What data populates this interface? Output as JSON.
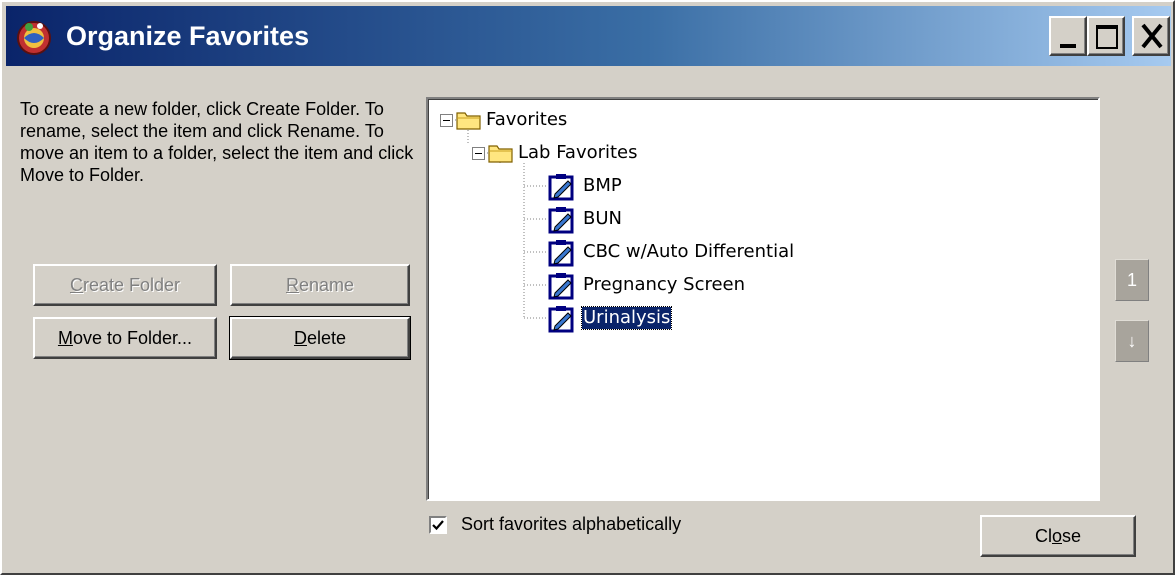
{
  "window": {
    "title": "Organize Favorites",
    "icon": "globe-icon"
  },
  "titlebar_buttons": {
    "minimize": "minimize-icon",
    "maximize": "maximize-icon",
    "close": "close-icon"
  },
  "instructions": "To create a new folder, click Create Folder.  To rename, select the item and click Rename.  To move an item to a folder, select the item and click Move to Folder.",
  "buttons": {
    "create_folder": {
      "pre": "",
      "key": "C",
      "post": "reate Folder",
      "enabled": false
    },
    "rename": {
      "pre": "",
      "key": "R",
      "post": "ename",
      "enabled": false
    },
    "move_to_folder": {
      "pre": "",
      "key": "M",
      "post": "ove to Folder...",
      "enabled": true
    },
    "delete": {
      "pre": "",
      "key": "D",
      "post": "elete",
      "enabled": true
    },
    "close": {
      "pre": "Cl",
      "key": "o",
      "post": "se",
      "enabled": true
    }
  },
  "tree": {
    "root": {
      "label": "Favorites",
      "icon": "folder-icon",
      "expanded": true
    },
    "folder": {
      "label": "Lab Favorites",
      "icon": "folder-icon",
      "expanded": true
    },
    "items": [
      {
        "label": "BMP",
        "icon": "clipboard-icon",
        "selected": false
      },
      {
        "label": "BUN",
        "icon": "clipboard-icon",
        "selected": false
      },
      {
        "label": "CBC w/Auto Differential",
        "icon": "clipboard-icon",
        "selected": false
      },
      {
        "label": "Pregnancy Screen",
        "icon": "clipboard-icon",
        "selected": false
      },
      {
        "label": "Urinalysis",
        "icon": "clipboard-icon",
        "selected": true
      }
    ]
  },
  "side_buttons": {
    "move_up": "1",
    "move_down": "↓"
  },
  "sort_checkbox": {
    "label": "Sort favorites alphabetically",
    "checked": true
  },
  "colors": {
    "titlebar_start": "#0a246a",
    "titlebar_end": "#a6caf0",
    "face": "#d4d0c8",
    "selection": "#0a246a"
  }
}
